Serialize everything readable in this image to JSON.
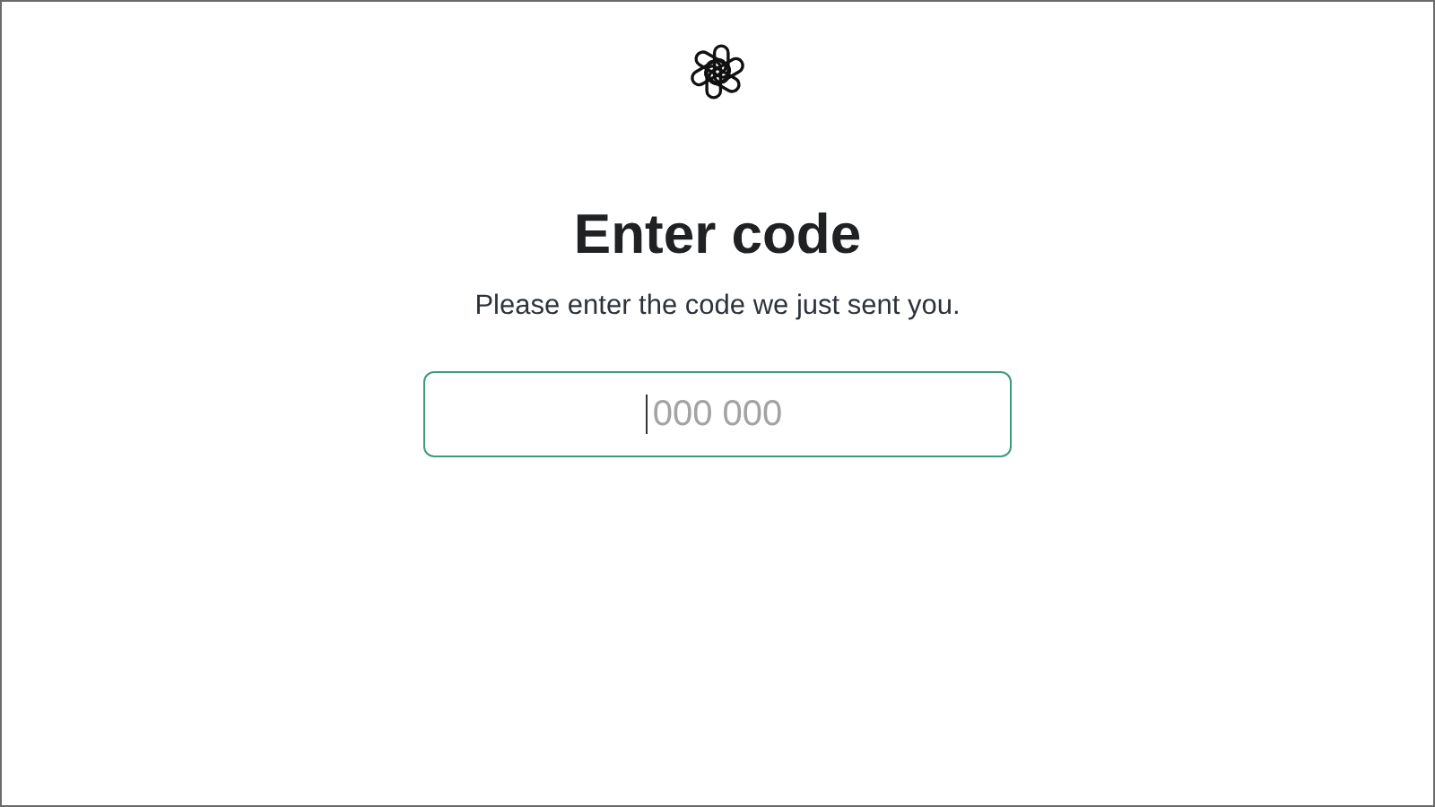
{
  "heading": "Enter code",
  "subtitle": "Please enter the code we just sent you.",
  "code_field": {
    "placeholder": "000 000",
    "focused": true
  }
}
